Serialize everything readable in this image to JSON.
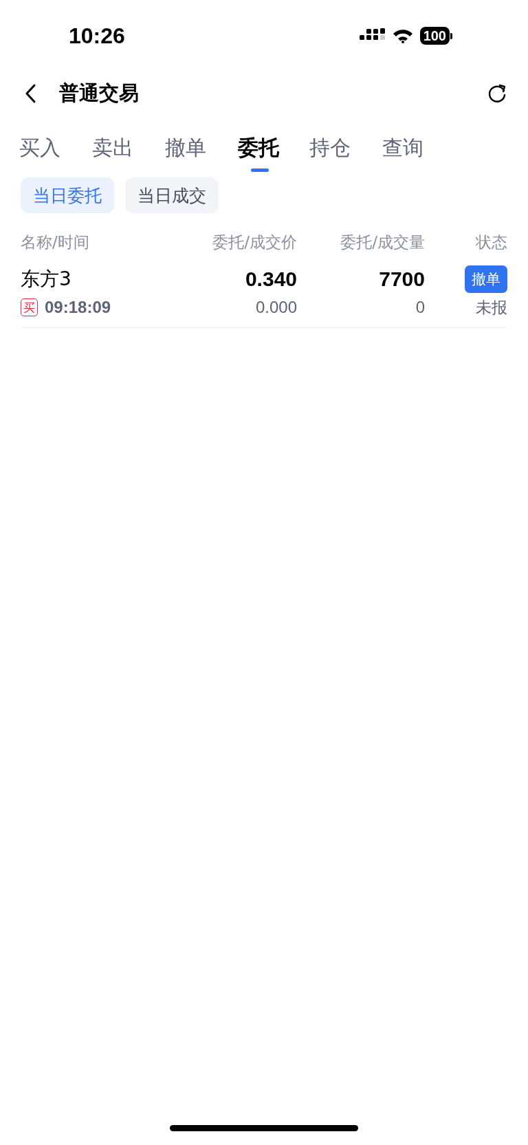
{
  "status_bar": {
    "time": "10:26",
    "battery": "100"
  },
  "nav": {
    "title": "普通交易"
  },
  "tabs": [
    {
      "label": "买入",
      "selected": false
    },
    {
      "label": "卖出",
      "selected": false
    },
    {
      "label": "撤单",
      "selected": false
    },
    {
      "label": "委托",
      "selected": true
    },
    {
      "label": "持仓",
      "selected": false
    },
    {
      "label": "查询",
      "selected": false
    }
  ],
  "filters": [
    {
      "label": "当日委托",
      "selected": true
    },
    {
      "label": "当日成交",
      "selected": false
    }
  ],
  "table": {
    "columns": [
      "名称/时间",
      "委托/成交价",
      "委托/成交量",
      "状态"
    ],
    "rows": [
      {
        "name": "东方3",
        "side": "买",
        "color": "#e8283c",
        "time": "09:18:09",
        "order_price": "0.340",
        "deal_price": "0.000",
        "order_qty": "7700",
        "deal_qty": "0",
        "action": "撤单",
        "status": "未报"
      }
    ]
  }
}
